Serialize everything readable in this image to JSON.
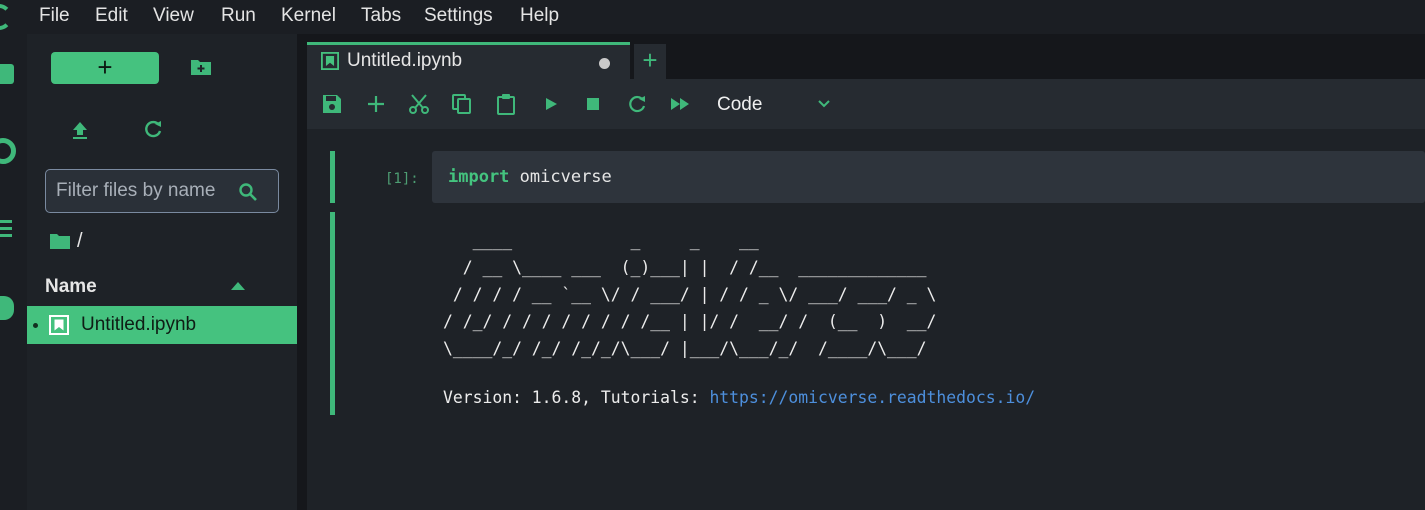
{
  "menu": {
    "items": [
      "File",
      "Edit",
      "View",
      "Run",
      "Kernel",
      "Tabs",
      "Settings",
      "Help"
    ]
  },
  "file_browser": {
    "new_button_label": "+",
    "filter_placeholder": "Filter files by name",
    "path": "/",
    "column_header": "Name",
    "files": [
      {
        "name": "Untitled.ipynb",
        "selected": true,
        "running": true
      }
    ]
  },
  "tab": {
    "label": "Untitled.ipynb",
    "add_label": "+"
  },
  "toolbar": {
    "cell_type": "Code"
  },
  "cell": {
    "execution_count": "[1]:",
    "code_keyword": "import",
    "code_rest": " omicverse",
    "output_ascii": "   ____            _     _    __                  \n  / __ \\____ ___  (_)___| |  / /__  _____________ \n / / / / __ `__ \\/ / ___/ | / / _ \\/ ___/ ___/ _ \\\n/ /_/ / / / / / / / /__ | |/ /  __/ /  (__  )  __/\n\\____/_/ /_/ /_/_/\\___/ |___/\\___/_/  /____/\\___/ ",
    "version_text": "Version: 1.6.8, Tutorials: ",
    "tutorial_url": "https://omicverse.readthedocs.io/"
  },
  "colors": {
    "accent": "#45c27f",
    "background": "#1e2227",
    "link": "#4d8fdc"
  }
}
